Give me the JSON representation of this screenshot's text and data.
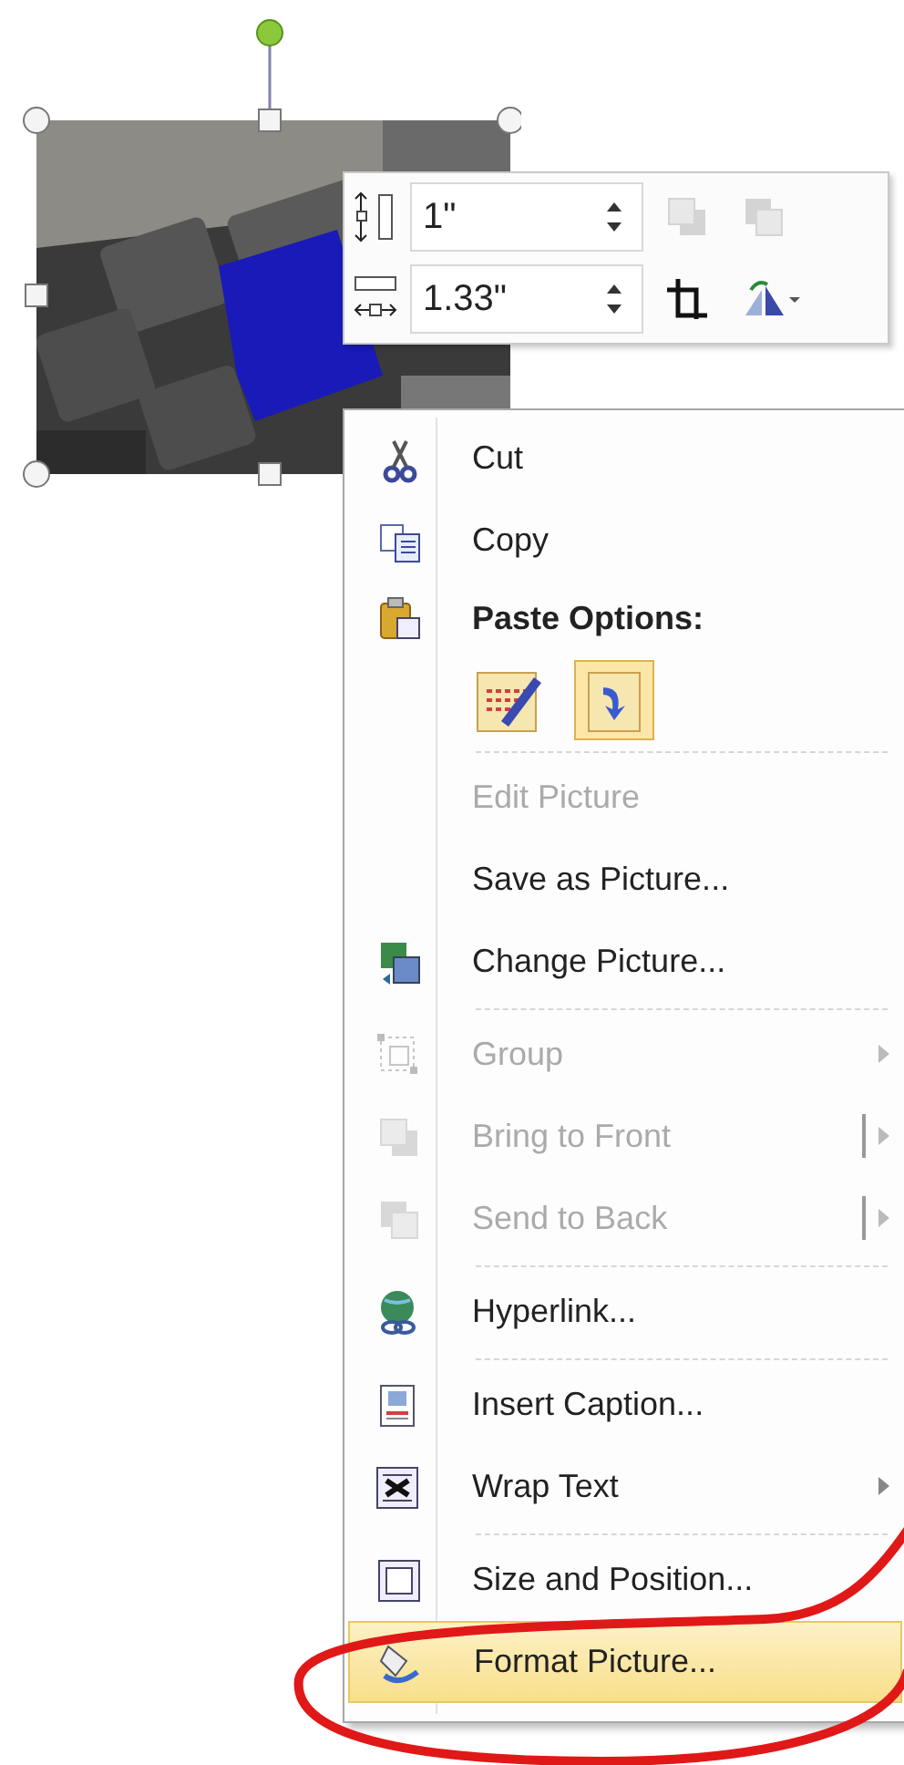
{
  "mini_toolbar": {
    "height_field": {
      "value": "1\""
    },
    "width_field": {
      "value": "1.33\""
    },
    "buttons": [
      {
        "kind": "bring-forward",
        "disabled": true
      },
      {
        "kind": "send-backward",
        "disabled": true
      },
      {
        "kind": "crop",
        "disabled": false
      },
      {
        "kind": "rotate",
        "disabled": false
      }
    ]
  },
  "context_menu": {
    "items": [
      {
        "kind": "command",
        "label": "Cut",
        "disabled": false,
        "selected": false,
        "submenu": false
      },
      {
        "kind": "command",
        "label": "Copy",
        "disabled": false,
        "selected": false,
        "submenu": false
      },
      {
        "kind": "header",
        "label": "Paste Options:"
      },
      {
        "kind": "paste-options",
        "options": [
          {
            "selected": false
          },
          {
            "selected": true
          }
        ]
      },
      {
        "kind": "separator"
      },
      {
        "kind": "command",
        "label": "Edit Picture",
        "disabled": true,
        "selected": false,
        "submenu": false
      },
      {
        "kind": "command",
        "label": "Save as Picture...",
        "disabled": false,
        "selected": false,
        "submenu": false
      },
      {
        "kind": "command",
        "label": "Change Picture...",
        "disabled": false,
        "selected": false,
        "submenu": false
      },
      {
        "kind": "separator"
      },
      {
        "kind": "command",
        "label": "Group",
        "disabled": true,
        "selected": false,
        "submenu": true
      },
      {
        "kind": "command",
        "label": "Bring to Front",
        "disabled": true,
        "selected": false,
        "submenu": true,
        "split": true
      },
      {
        "kind": "command",
        "label": "Send to Back",
        "disabled": true,
        "selected": false,
        "submenu": true,
        "split": true
      },
      {
        "kind": "separator"
      },
      {
        "kind": "command",
        "label": "Hyperlink...",
        "disabled": false,
        "selected": false,
        "submenu": false
      },
      {
        "kind": "separator"
      },
      {
        "kind": "command",
        "label": "Insert Caption...",
        "disabled": false,
        "selected": false,
        "submenu": false
      },
      {
        "kind": "command",
        "label": "Wrap Text",
        "disabled": false,
        "selected": false,
        "submenu": true
      },
      {
        "kind": "separator"
      },
      {
        "kind": "command",
        "label": "Size and Position...",
        "disabled": false,
        "selected": false,
        "submenu": false
      },
      {
        "kind": "command",
        "label": "Format Picture...",
        "disabled": false,
        "selected": true,
        "submenu": false
      }
    ]
  }
}
